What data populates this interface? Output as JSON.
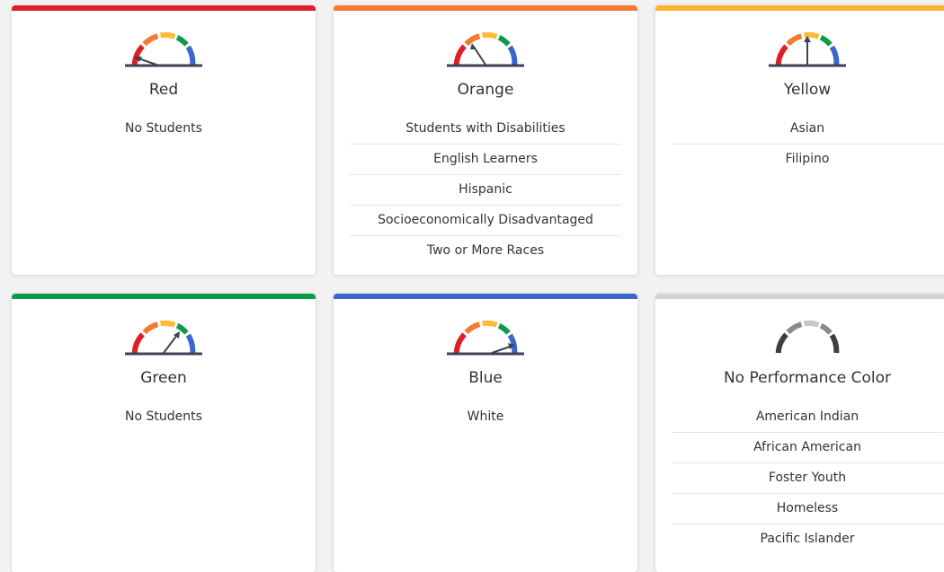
{
  "gauge_colors": {
    "red": "#e01e25",
    "orange": "#f47a34",
    "yellow": "#fdbc34",
    "green": "#0c9c48",
    "blue": "#3a67cb",
    "base": "#3b4252"
  },
  "cards": [
    {
      "title": "Red",
      "accent": "#dc1f2e",
      "empty_text": "No Students",
      "groups": []
    },
    {
      "title": "Orange",
      "accent": "#f47a34",
      "empty_text": "",
      "groups": [
        "Students with Disabilities",
        "English Learners",
        "Hispanic",
        "Socioeconomically Disadvantaged",
        "Two or More Races"
      ]
    },
    {
      "title": "Yellow",
      "accent": "#fbb431",
      "empty_text": "",
      "groups": [
        "Asian",
        "Filipino"
      ]
    },
    {
      "title": "Green",
      "accent": "#0c9c48",
      "empty_text": "No Students",
      "groups": []
    },
    {
      "title": "Blue",
      "accent": "#3a67cb",
      "empty_text": "White",
      "groups": []
    },
    {
      "title": "No Performance Color",
      "accent": "#d3d3d3",
      "empty_text": "",
      "groups": [
        "American Indian",
        "African American",
        "Foster Youth",
        "Homeless",
        "Pacific Islander"
      ]
    }
  ]
}
